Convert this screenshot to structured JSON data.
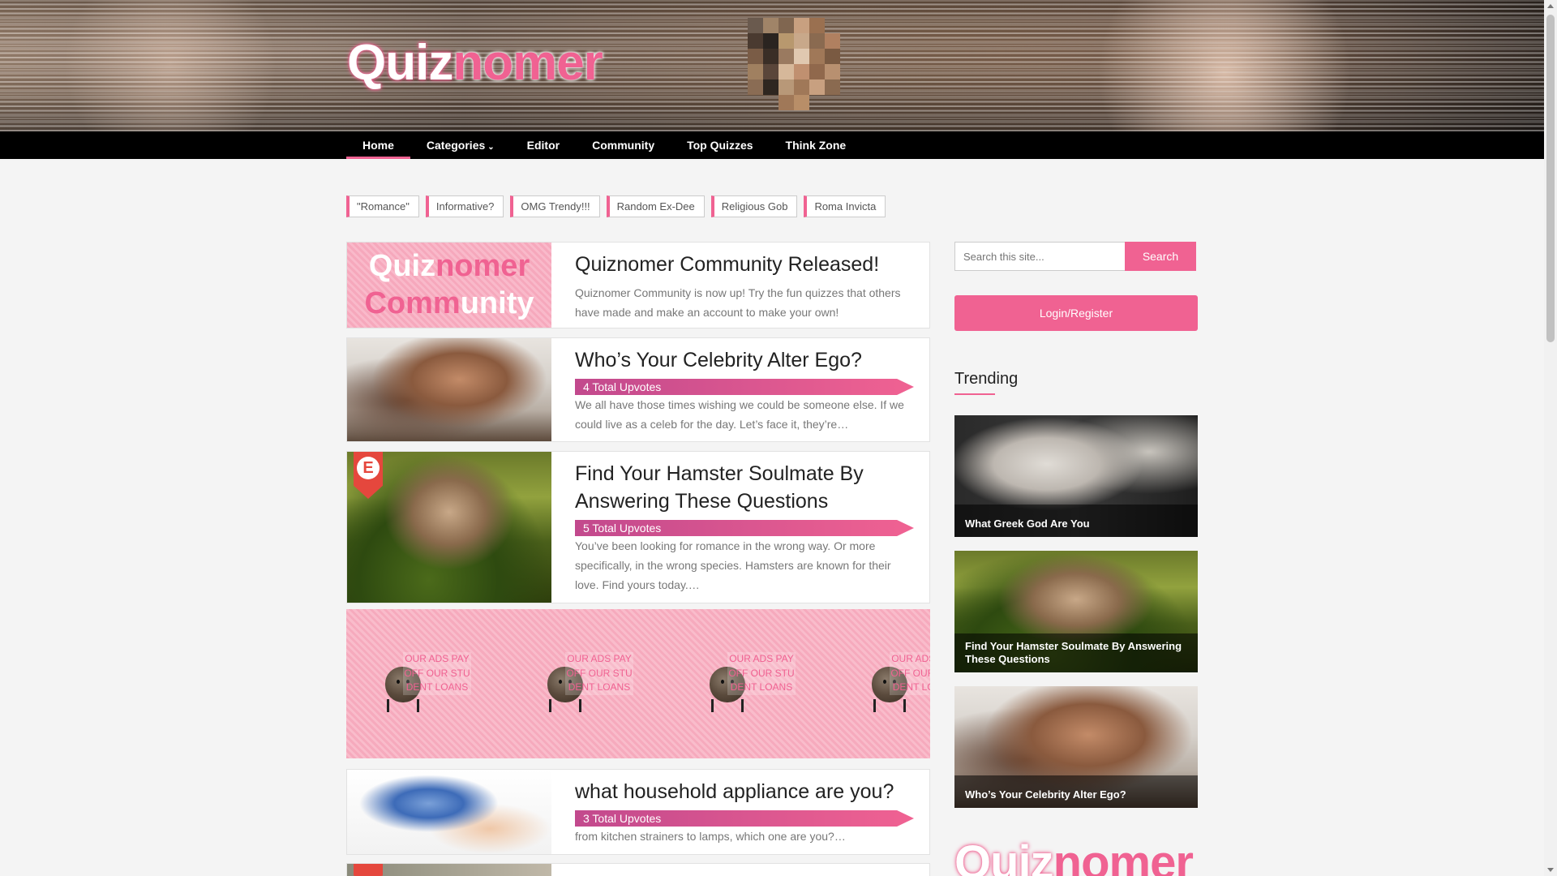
{
  "colors": {
    "accent": "#f06292",
    "nav_bg": "#000000",
    "page_bg": "#f4f4f4"
  },
  "header": {
    "logo_part1": "Quiz",
    "logo_part2": "nomer"
  },
  "nav": {
    "items": [
      {
        "label": "Home",
        "active": true
      },
      {
        "label": "Categories",
        "icon": "chevron-down-icon"
      },
      {
        "label": "Editor"
      },
      {
        "label": "Community"
      },
      {
        "label": "Top Quizzes"
      },
      {
        "label": "Think Zone"
      }
    ]
  },
  "tags": [
    "\"Romance\"",
    "Informative?",
    "OMG Trendy!!!",
    "Random Ex-Dee",
    "Religious Gob",
    "Roma Invicta"
  ],
  "posts": [
    {
      "title": "Quiznomer Community Released!",
      "thumb_text_1a": "Quiz",
      "thumb_text_1b": "nomer",
      "thumb_text_2a": "Comm",
      "thumb_text_2b": "unity",
      "excerpt": "Quiznomer Community is now up! Try the fun quizzes that others have made and make an account to make your own!"
    },
    {
      "title": "Who’s Your Celebrity Alter Ego?",
      "upvotes": "4 Total Upvotes",
      "excerpt": "We all have those times wishing we could be someone else. If we could live as a celeb for the day. Let’s face it, they’re…"
    },
    {
      "title": "Find Your Hamster Soulmate By Answering These Questions",
      "badge": "E",
      "upvotes": "5 Total Upvotes",
      "excerpt": "You’ve been looking for romance in the wrong way. Or more specifically, in the wrong species. Hamsters are known for their love. Find yours today.…"
    },
    {
      "title": "what household appliance are you?",
      "upvotes": "3 Total Upvotes",
      "excerpt": "from kitchen strainers to lamps, which one are you?…"
    }
  ],
  "ad": {
    "text": "OUR ADS PAY OFF OUR STU DENT LOANS"
  },
  "sidebar": {
    "search_placeholder": "Search this site...",
    "search_button": "Search",
    "login_button": "Login/Register",
    "trending_title": "Trending",
    "trending": [
      {
        "title": "What Greek God Are You"
      },
      {
        "title": "Find Your Hamster Soulmate By Answering These Questions"
      },
      {
        "title": "Who’s Your Celebrity Alter Ego?"
      }
    ],
    "logo_part1": "Quiz",
    "logo_part2": "nomer"
  }
}
